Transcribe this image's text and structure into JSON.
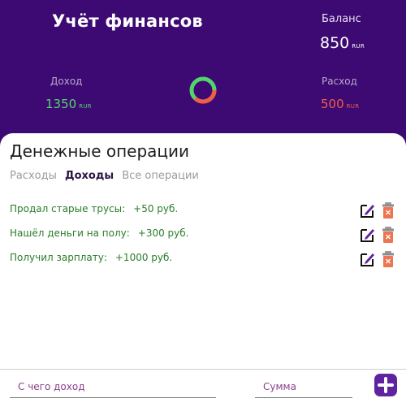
{
  "app": {
    "title": "Учёт финансов"
  },
  "balance": {
    "label": "Баланс",
    "value": "850",
    "currency": "RUR"
  },
  "income": {
    "label": "Доход",
    "value": "1350",
    "currency": "RUR"
  },
  "expense": {
    "label": "Расход",
    "value": "500",
    "currency": "RUR"
  },
  "colors": {
    "header_bg": "#3d0a73",
    "income": "#54d46d",
    "expense": "#f35d47",
    "operation_text": "#2a7d2a",
    "accent": "#5f239f"
  },
  "operations": {
    "title": "Денежные операции",
    "tabs": [
      {
        "label": "Расходы",
        "active": false
      },
      {
        "label": "Доходы",
        "active": true
      },
      {
        "label": "Все операции",
        "active": false
      }
    ],
    "items": [
      {
        "description": "Продал старые трусы:",
        "amount": "+50 руб."
      },
      {
        "description": "Нашёл деньги на полу:",
        "amount": "+300 руб."
      },
      {
        "description": "Получил зарплату:",
        "amount": "+1000 руб."
      }
    ],
    "item_icons": {
      "edit": "edit-icon",
      "delete": "trash-icon"
    }
  },
  "form": {
    "source_placeholder": "С чего доход",
    "amount_placeholder": "Сумма",
    "add_icon": "plus-icon"
  }
}
